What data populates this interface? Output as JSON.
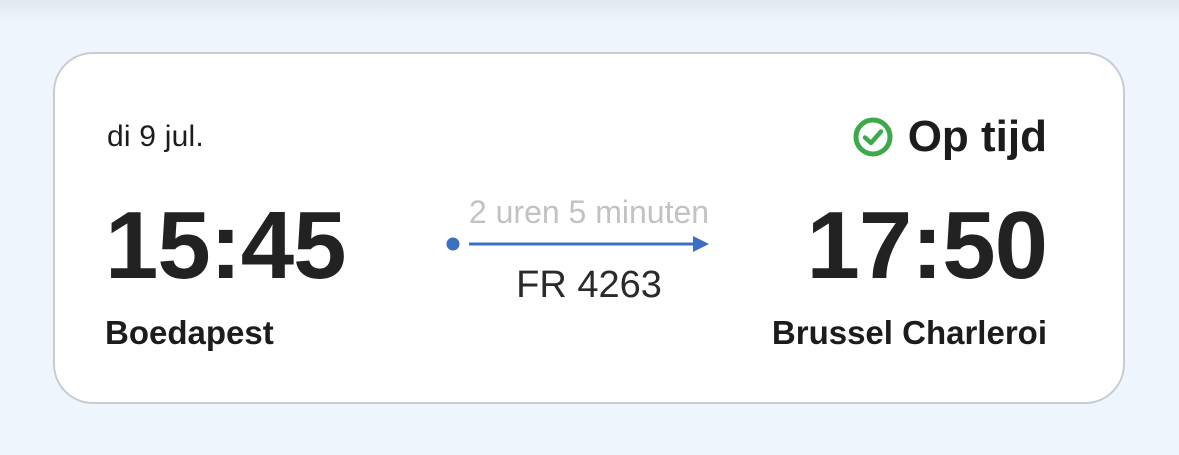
{
  "flight": {
    "date": "di 9 jul.",
    "status": "Op tijd",
    "departure_time": "15:45",
    "departure_city": "Boedapest",
    "arrival_time": "17:50",
    "arrival_city": "Brussel Charleroi",
    "duration": "2 uren 5 minuten",
    "flight_number": "FR 4263"
  },
  "icons": {
    "status": "check-circle-icon",
    "route": "route-arrow-icon"
  },
  "colors": {
    "status_green": "#3daa4a",
    "route_blue": "#3a6fc4",
    "background": "#eef5fd"
  }
}
